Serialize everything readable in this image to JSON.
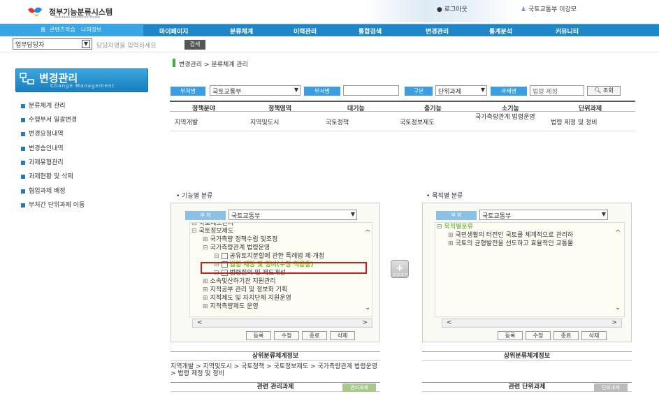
{
  "header": {
    "logo_text": "정부기능분류시스템",
    "logo_sub": "Business Reference Model",
    "login_link": "로그아웃",
    "user_info": "국토교통부 이강모"
  },
  "nav": {
    "home_links": [
      "홈",
      "콘텐츠학습",
      "나의정보"
    ],
    "items": [
      "마이페이지",
      "분류체계",
      "이력관리",
      "통합검색",
      "변경관리",
      "통계분석",
      "커뮤니티"
    ]
  },
  "search": {
    "role_value": "업무담당자",
    "placeholder": "담당자명을 입력하세요",
    "button": "검색"
  },
  "sidebar": {
    "title": "변경관리",
    "subtitle": "Change Management",
    "items": [
      "분류체계 관리",
      "수행부서 일괄변경",
      "변경요청내역",
      "변경승인내역",
      "과제유형관리",
      "과제현황 및 삭제",
      "협업과제 배정",
      "부처간 단위과제 이동"
    ]
  },
  "breadcrumb": "변경관리 > 분류체계 관리",
  "filters": {
    "ministry_label": "부처명",
    "ministry_value": "국토교통부",
    "dept_label": "부서명",
    "dept_value": "",
    "type_label": "구분",
    "type_value": "단위과제",
    "task_label": "과제명",
    "task_value": "법령 제정",
    "query_button": "조회"
  },
  "grid": {
    "headers": [
      "정책분야",
      "정책영역",
      "대기능",
      "중기능",
      "소기능",
      "단위과제"
    ],
    "rows": [
      [
        "지역개발",
        "지역및도시",
        "국토정책",
        "국토정보제도",
        "국가측량관계 법령운영",
        "법령 제정 및 정비"
      ]
    ]
  },
  "left_panel": {
    "section_title": "• 기능별 분류",
    "ministry_tag": "부 처",
    "ministry_value": "국토교통부",
    "tree": [
      {
        "indent": 0,
        "toggle": "⊟",
        "label": "국토제도관리",
        "cut": true
      },
      {
        "indent": 0,
        "toggle": "⊟",
        "label": "국토정보제도"
      },
      {
        "indent": 1,
        "toggle": "⊞",
        "label": "국가측량 정책수립 및조정"
      },
      {
        "indent": 1,
        "toggle": "⊟",
        "label": "국가측량관계 법령운영"
      },
      {
        "indent": 2,
        "toggle": "⊟",
        "label": "공유토지분할에 관한 특례법 제·개정",
        "check": true
      },
      {
        "indent": 2,
        "toggle": "⊟",
        "label": "법령 제정 및 정비(수정 적용중)",
        "check": true,
        "highlight": true
      },
      {
        "indent": 2,
        "toggle": "⊟",
        "label": "법령질의 및 제도개선",
        "check": true
      },
      {
        "indent": 1,
        "toggle": "⊞",
        "label": "소속및산하기관 지원관리"
      },
      {
        "indent": 1,
        "toggle": "⊞",
        "label": "지적공부 관리 및 정보화 기획"
      },
      {
        "indent": 1,
        "toggle": "⊞",
        "label": "지적제도 및 자치단체 지원운영"
      },
      {
        "indent": 1,
        "toggle": "⊞",
        "label": "지적측량제도 운영"
      }
    ],
    "actions": [
      "등록",
      "수정",
      "종료",
      "삭제"
    ],
    "info_title": "상위분류체계정보",
    "info_path": "지역개발 > 지역및도시 > 국토정책 > 국토정보제도 > 국가측량관계 법령운영 > 법령 제정 및 정비",
    "related_title": "관련 관리과제",
    "related_button": "관리과제"
  },
  "add_button": {
    "symbol": "+",
    "label": "업무추가"
  },
  "right_panel": {
    "section_title": "• 목적별 분류",
    "ministry_tag": "부 처",
    "ministry_value": "국토교통부",
    "tree": [
      {
        "indent": 0,
        "toggle": "⊟",
        "label": "목적별분류",
        "green": true
      },
      {
        "indent": 1,
        "toggle": "⊞",
        "label": "국민생활의 터전인 국토를 체계적으로 관리하"
      },
      {
        "indent": 1,
        "toggle": "⊞",
        "label": "국토의 균형발전을 선도하고 효율적인 교통물"
      }
    ],
    "actions": [
      "등록",
      "수정",
      "종료",
      "삭제"
    ],
    "info_title": "상위분류체계정보",
    "related_title": "관련 단위과제",
    "related_button": "단위과제"
  },
  "colors": {
    "nav_bg": "#1f86c8",
    "accent": "#3a9ee0",
    "highlight_border": "#d21c1c",
    "tree_green": "#5aa82a"
  }
}
